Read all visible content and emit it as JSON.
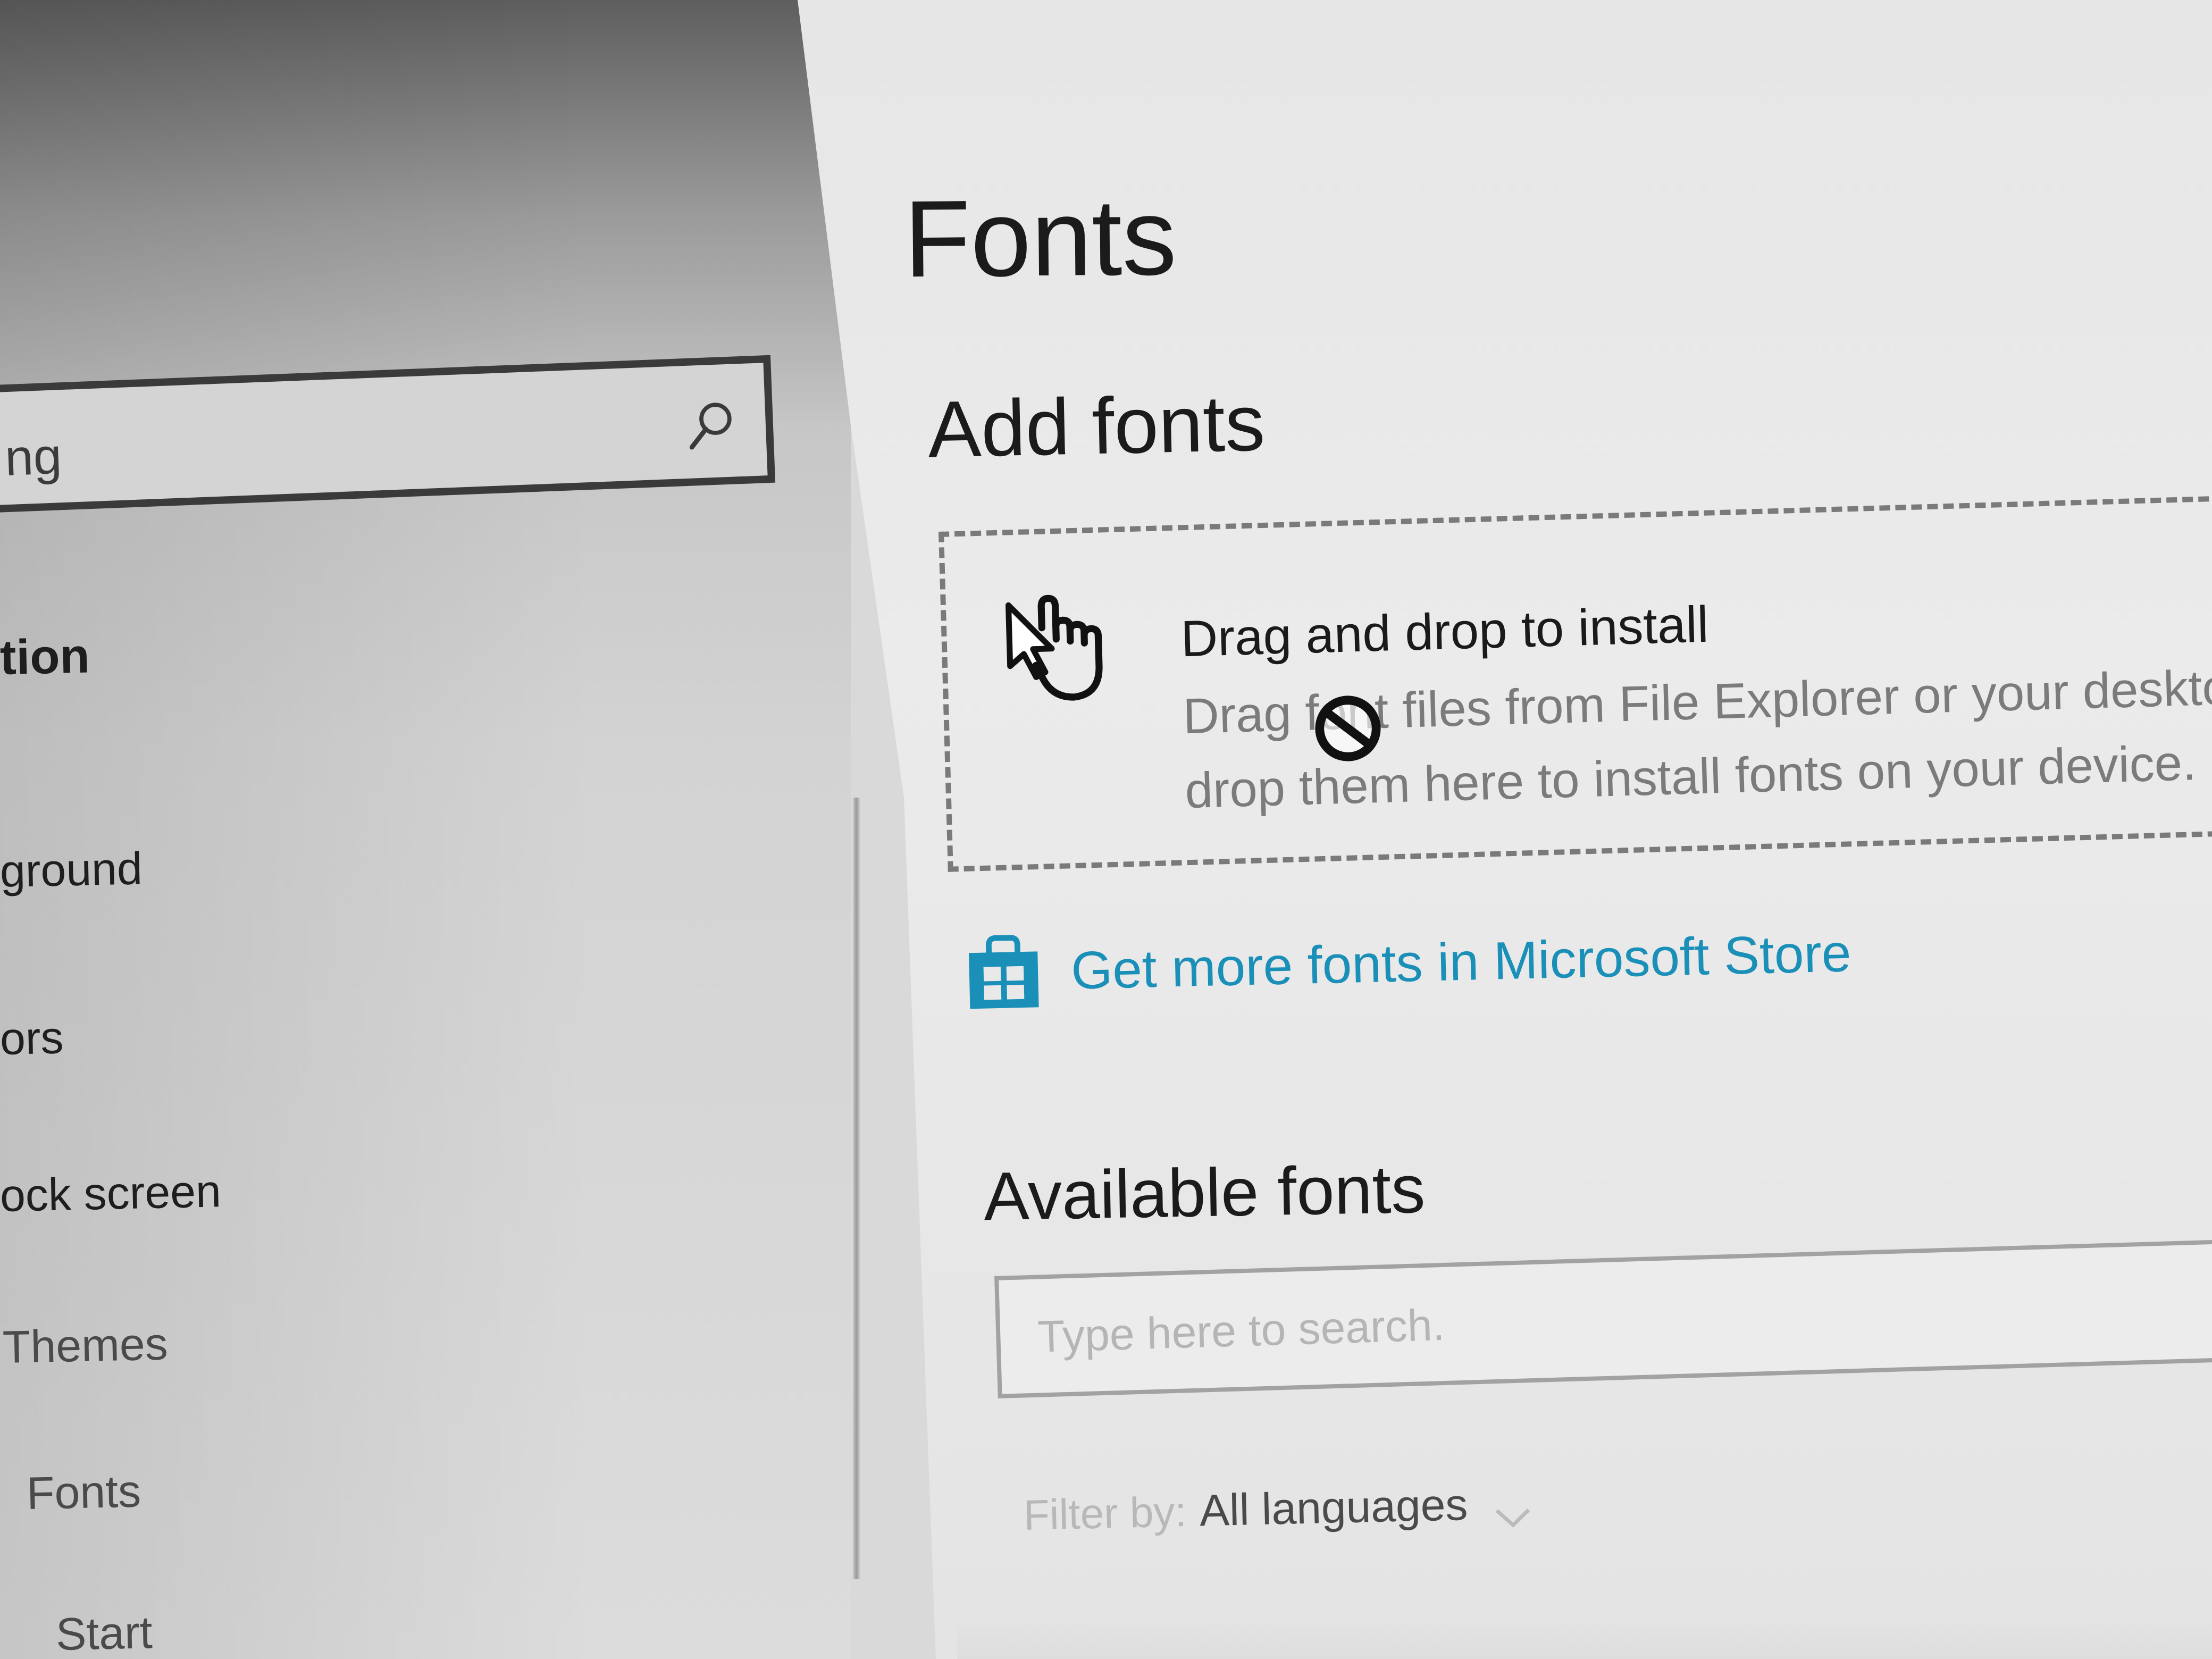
{
  "sidebar": {
    "search_value": "ng",
    "items": [
      {
        "label": "tion"
      },
      {
        "label": "ground"
      },
      {
        "label": "ors"
      },
      {
        "label": "ock screen"
      },
      {
        "label": "Themes"
      },
      {
        "label": "Fonts"
      },
      {
        "label": "Start"
      }
    ]
  },
  "main": {
    "title": "Fonts",
    "add_fonts": {
      "heading": "Add fonts",
      "drop_title": "Drag and drop to install",
      "drop_description": "Drag font files from File Explorer or your deskto drop them here to install fonts on your device.",
      "store_link": "Get more fonts in Microsoft Store"
    },
    "available_fonts": {
      "heading": "Available fonts",
      "search_placeholder": "Type here to search.",
      "filter_label": "Filter by:",
      "filter_value": "All languages"
    }
  },
  "colors": {
    "accent": "#1a8fb8",
    "text": "#1b1b1b",
    "secondary_text": "#7b7b7b"
  },
  "icons": {
    "search": "search-icon",
    "hand": "hand-pointer-icon",
    "no_drop": "no-drop-icon",
    "store": "store-bag-icon",
    "chevron": "chevron-down-icon"
  }
}
